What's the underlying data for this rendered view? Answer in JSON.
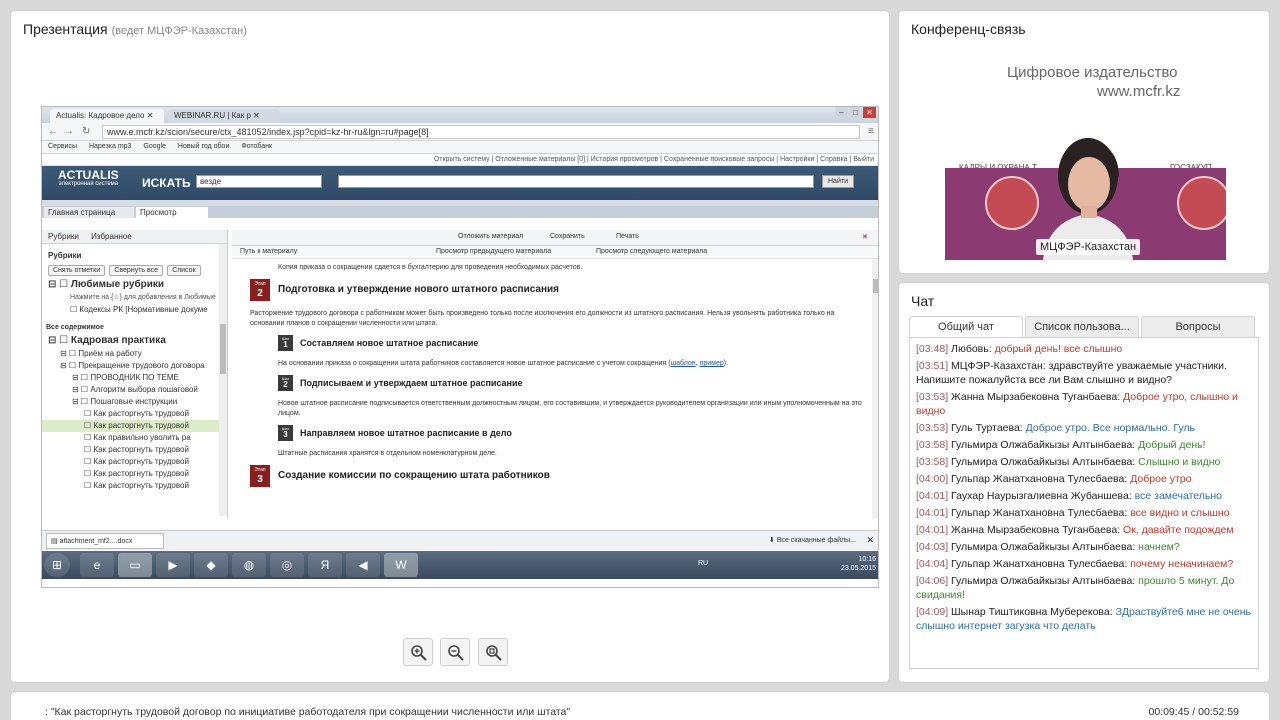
{
  "presentation": {
    "title": "Презентация",
    "host": "(ведет МЦФЭР-Казахстан)"
  },
  "browser": {
    "tabs": [
      "Actualis: Кадровое дело",
      "WEBINAR.RU | Как р"
    ],
    "url": "www.e.mcfr.kz/scion/secure/ctx_481052/index.jsp?cpid=kz-hr-ru&lgn=ru#page[8]",
    "bookmarks": [
      "Сервисы",
      "Нарезка mp3",
      "Google",
      "Новый год обои",
      "Фотобанк"
    ]
  },
  "actualis": {
    "top_links": "Открыть систему | Отложенные материалы [0] | История просмотров | Сохраненные поисковые запросы | Настройки | Справка | Выйти",
    "logo": "ACTUALIS",
    "logo_sub": "электронная система",
    "search_label": "ИСКАТЬ",
    "search_scope": "везде",
    "search_button": "Найти",
    "doc_tabs": [
      "Главная страница",
      "Просмотр"
    ]
  },
  "sidebar": {
    "tabs": [
      "Рубрики",
      "Избранное"
    ],
    "title": "Рубрики",
    "buttons": [
      "Снять отметки",
      "Свернуть все",
      "Список"
    ],
    "favorites_title": "Любимые рубрики",
    "favorites_note": "Нажмите на {☆} для добавления в Любимые",
    "codes": "Кодексы РК [Нормативные докуме",
    "all_content": "Все содержимое",
    "tree": [
      {
        "text": "Кадровая практика",
        "level": 1,
        "big": true
      },
      {
        "text": "Приём на работу",
        "level": 2
      },
      {
        "text": "Прекращение трудового договора",
        "level": 2
      },
      {
        "text": "ПРОВОДНИК ПО ТЕМЕ",
        "level": 3
      },
      {
        "text": "Алгоритм выбора пошаговой",
        "level": 3
      },
      {
        "text": "Пошаговые инструкции",
        "level": 3
      },
      {
        "text": "Как расторгнуть трудовой",
        "level": 4
      },
      {
        "text": "Как расторгнуть трудовой",
        "level": 4,
        "hl": true
      },
      {
        "text": "Как правильно уволить ра",
        "level": 4
      },
      {
        "text": "Как расторгнуть трудовой",
        "level": 4
      },
      {
        "text": "Как расторгнуть трудовой",
        "level": 4
      },
      {
        "text": "Как расторгнуть трудовой",
        "level": 4
      },
      {
        "text": "Как расторгнуть трудовой",
        "level": 4
      }
    ]
  },
  "content": {
    "toolbar": [
      "Отложить материал",
      "Сохранить",
      "Печать"
    ],
    "nav": [
      "Путь к материалу",
      "Просмотр предыдущего материала",
      "Просмотр следующего материала"
    ],
    "intro": "Копия приказа о сокращении сдается в бухгалтерию для проведения необходимых расчетов.",
    "stage_label": "Этап",
    "step_label": "Шаг",
    "stage2": {
      "num": "2",
      "title": "Подготовка и утверждение нового штатного расписания",
      "text": "Расторжение трудового договора с работником может быть произведено только после исключения его должности из штатного расписания. Нельзя увольнять работника только на основании планов о сокращении численности или штата."
    },
    "steps": [
      {
        "num": "1",
        "title": "Составляем новое штатное расписание",
        "text": "На основании приказа о сокращении штата работников составляется новое штатное расписание с учетом сокращения (",
        "link1": "шаблон",
        "sep": ", ",
        "link2": "пример",
        "end": ")."
      },
      {
        "num": "2",
        "title": "Подписываем и утверждаем штатное расписание",
        "text": "Новое штатное расписание подписывается ответственным должностным лицом, его составившим, и утверждается руководителем организации или иным уполномоченным на это лицом."
      },
      {
        "num": "3",
        "title": "Направляем новое штатное расписание в дело",
        "text": "Штатные расписания хранятся в отдельном номенклатурном деле."
      }
    ],
    "stage3": {
      "num": "3",
      "title": "Создание комиссии по сокращению штата работников"
    }
  },
  "downloads": {
    "file": "attachment_mf2....docx",
    "all": "Все скачанные файлы..."
  },
  "taskbar": {
    "lang": "RU",
    "time": "10:16",
    "date": "23.05.2015"
  },
  "conference": {
    "title": "Конференц-связь",
    "banner_line1": "Цифровое издательство",
    "banner_line2": "www.mcfr.kz",
    "label_left": "КАДРЫ И ОХРАНА Т",
    "label_right": "ГОСЗАКУП",
    "speaker": "МЦФЭР-Казахстан"
  },
  "chat": {
    "title": "Чат",
    "tabs": [
      "Общий чат",
      "Список пользова...",
      "Вопросы"
    ],
    "messages": [
      {
        "time": "[03:48]",
        "author": "Любовь:",
        "text": "добрый день! все слышно",
        "color": "red"
      },
      {
        "time": "[03:51]",
        "author": "МЦФЭР-Казахстан:",
        "text": "здравствуйте уважаемые участники. Напишите пожалуйста все ли Вам слышно и видно?",
        "color": "dark"
      },
      {
        "time": "[03:53]",
        "author": "Жанна Мырзабековна Туганбаева:",
        "text": "Доброе утро, слышно и видно",
        "color": "red"
      },
      {
        "time": "[03:53]",
        "author": "Гуль Туртаева:",
        "text": "Доброе утро. Все нормально. Гуль",
        "color": "blue"
      },
      {
        "time": "[03:58]",
        "author": "Гульмира Олжабайкызы Алтынбаева:",
        "text": "Добрый день!",
        "color": "green"
      },
      {
        "time": "[03:58]",
        "author": "Гульмира Олжабайкызы Алтынбаева:",
        "text": "Слышно и видно",
        "color": "green"
      },
      {
        "time": "[04:00]",
        "author": "Гульпар Жанатхановна Тулесбаева:",
        "text": "Доброе утро",
        "color": "red"
      },
      {
        "time": "[04:01]",
        "author": "Гаухар Наурызгалиевна Жубаншева:",
        "text": "все замечательно",
        "color": "blue"
      },
      {
        "time": "[04:01]",
        "author": "Гульпар Жанатхановна Тулесбаева:",
        "text": "все видно и слышно",
        "color": "red"
      },
      {
        "time": "[04:01]",
        "author": "Жанна Мырзабековна Туганбаева:",
        "text": "Ок, давайте подождем",
        "color": "red"
      },
      {
        "time": "[04:03]",
        "author": "Гульмира Олжабайкызы Алтынбаева:",
        "text": "начнем?",
        "color": "green"
      },
      {
        "time": "[04:04]",
        "author": "Гульпар Жанатхановна Тулесбаева:",
        "text": "почему неначинаем?",
        "color": "red"
      },
      {
        "time": "[04:06]",
        "author": "Гульмира Олжабайкызы Алтынбаева:",
        "text": "прошло 5 минут. До свидания!",
        "color": "green"
      },
      {
        "time": "[04:09]",
        "author": "Шынар Тиштиковна Муберекова:",
        "text": "ЗДраствуйте6 мне не очень слышно интернет загузка что делать",
        "color": "blue"
      }
    ]
  },
  "footer": {
    "lecture": ":  \"Как расторгнуть трудовой договор по инициативе работодателя при сокращении численности или штата\"",
    "timer": "00:09:45 / 00:52:59"
  }
}
